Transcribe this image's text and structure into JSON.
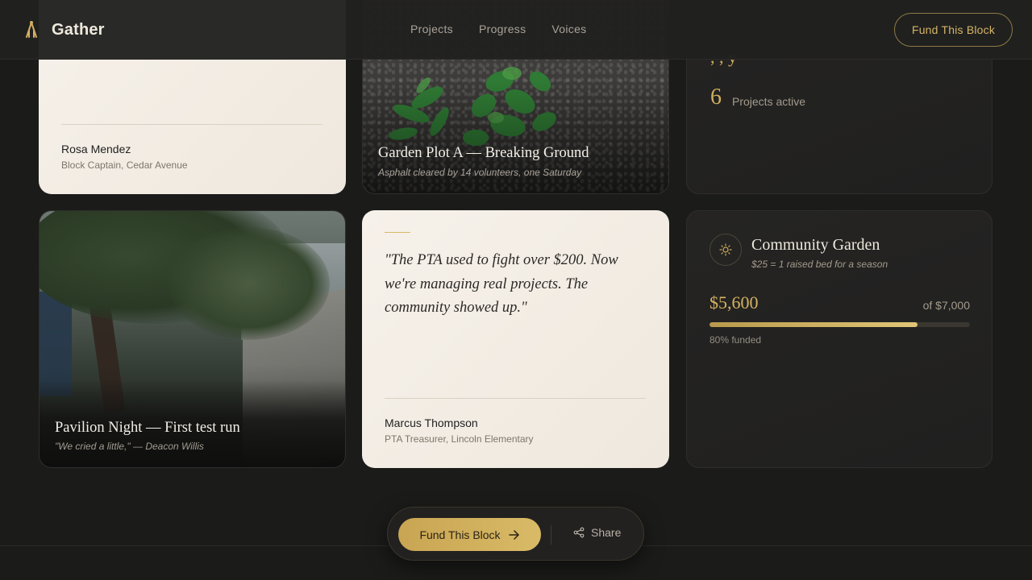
{
  "nav": {
    "brand": "Gather",
    "links": [
      "Projects",
      "Progress",
      "Voices"
    ],
    "cta": "Fund This Block"
  },
  "cards": {
    "rosa": {
      "name": "Rosa Mendez",
      "role": "Block Captain, Cedar Avenue"
    },
    "garden_plot": {
      "title": "Garden Plot A — Breaking Ground",
      "subtitle": "Asphalt cleared by 14 volunteers, one Saturday"
    },
    "stats": {
      "partial_top": ", , y",
      "active_count": "6",
      "active_label": "Projects active"
    },
    "pavilion": {
      "title": "Pavilion Night — First test run",
      "subtitle": "\"We cried a little,\" — Deacon Willis"
    },
    "quote": {
      "text": "\"The PTA used to fight over $200. Now we're managing real projects. The community showed up.\"",
      "name": "Marcus Thompson",
      "role": "PTA Treasurer, Lincoln Elementary"
    },
    "fund": {
      "icon": "sun-icon",
      "title": "Community Garden",
      "subtitle": "$25 = 1 raised bed for a season",
      "raised": "$5,600",
      "goal": "of $7,000",
      "progress_fraction": 0.8,
      "percent_label": "80% funded"
    }
  },
  "action_bar": {
    "fund_label": "Fund This Block",
    "share_label": "Share"
  },
  "colors": {
    "background": "#1b1b1a",
    "accent_gold": "#d5b463",
    "light_card": "#f3ede4"
  }
}
